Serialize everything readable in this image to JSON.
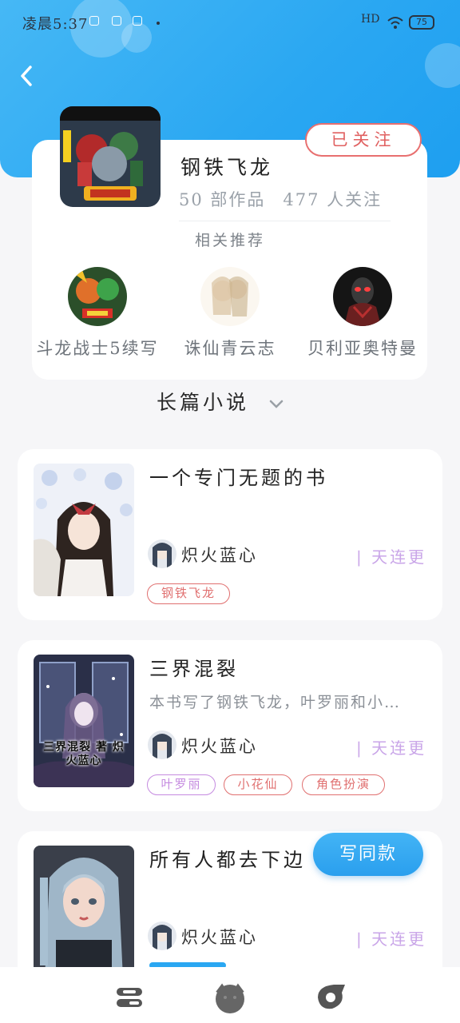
{
  "status_bar": {
    "time": "凌晨5:37",
    "right_text": "HD",
    "battery": "75"
  },
  "author": {
    "name": "钢铁飞龙",
    "works": "50 部作品",
    "followers": "477 人关注",
    "follow_label": "已关注"
  },
  "recommendations": {
    "title": "相关推荐",
    "items": [
      {
        "name": "斗龙战士5续写"
      },
      {
        "name": "诛仙青云志"
      },
      {
        "name": "贝利亚奥特曼"
      }
    ]
  },
  "category": {
    "selected": "长篇小说"
  },
  "books": [
    {
      "title": "一个专门无题的书",
      "description": "",
      "author": "炽火蓝心",
      "status": "| 天连更",
      "tags": [
        "钢铁飞龙"
      ]
    },
    {
      "title": "三界混裂",
      "description": "本书写了钢铁飞龙，叶罗丽和小…",
      "author": "炽火蓝心",
      "status": "| 天连更",
      "tags": [
        "叶罗丽",
        "小花仙",
        "角色扮演"
      ],
      "cover_caption": "三界混裂 著 炽火蓝心"
    },
    {
      "title": "所有人都去下边",
      "description": "",
      "author": "炽火蓝心",
      "status": "| 天连更",
      "tags": []
    }
  ],
  "same_style_button": "写同款",
  "colors": {
    "header": "#2aa7f2",
    "follow": "#e06060",
    "status_purple": "#c9a5e8",
    "tag_red": "#e07070",
    "tag_purple": "#c58be0"
  }
}
